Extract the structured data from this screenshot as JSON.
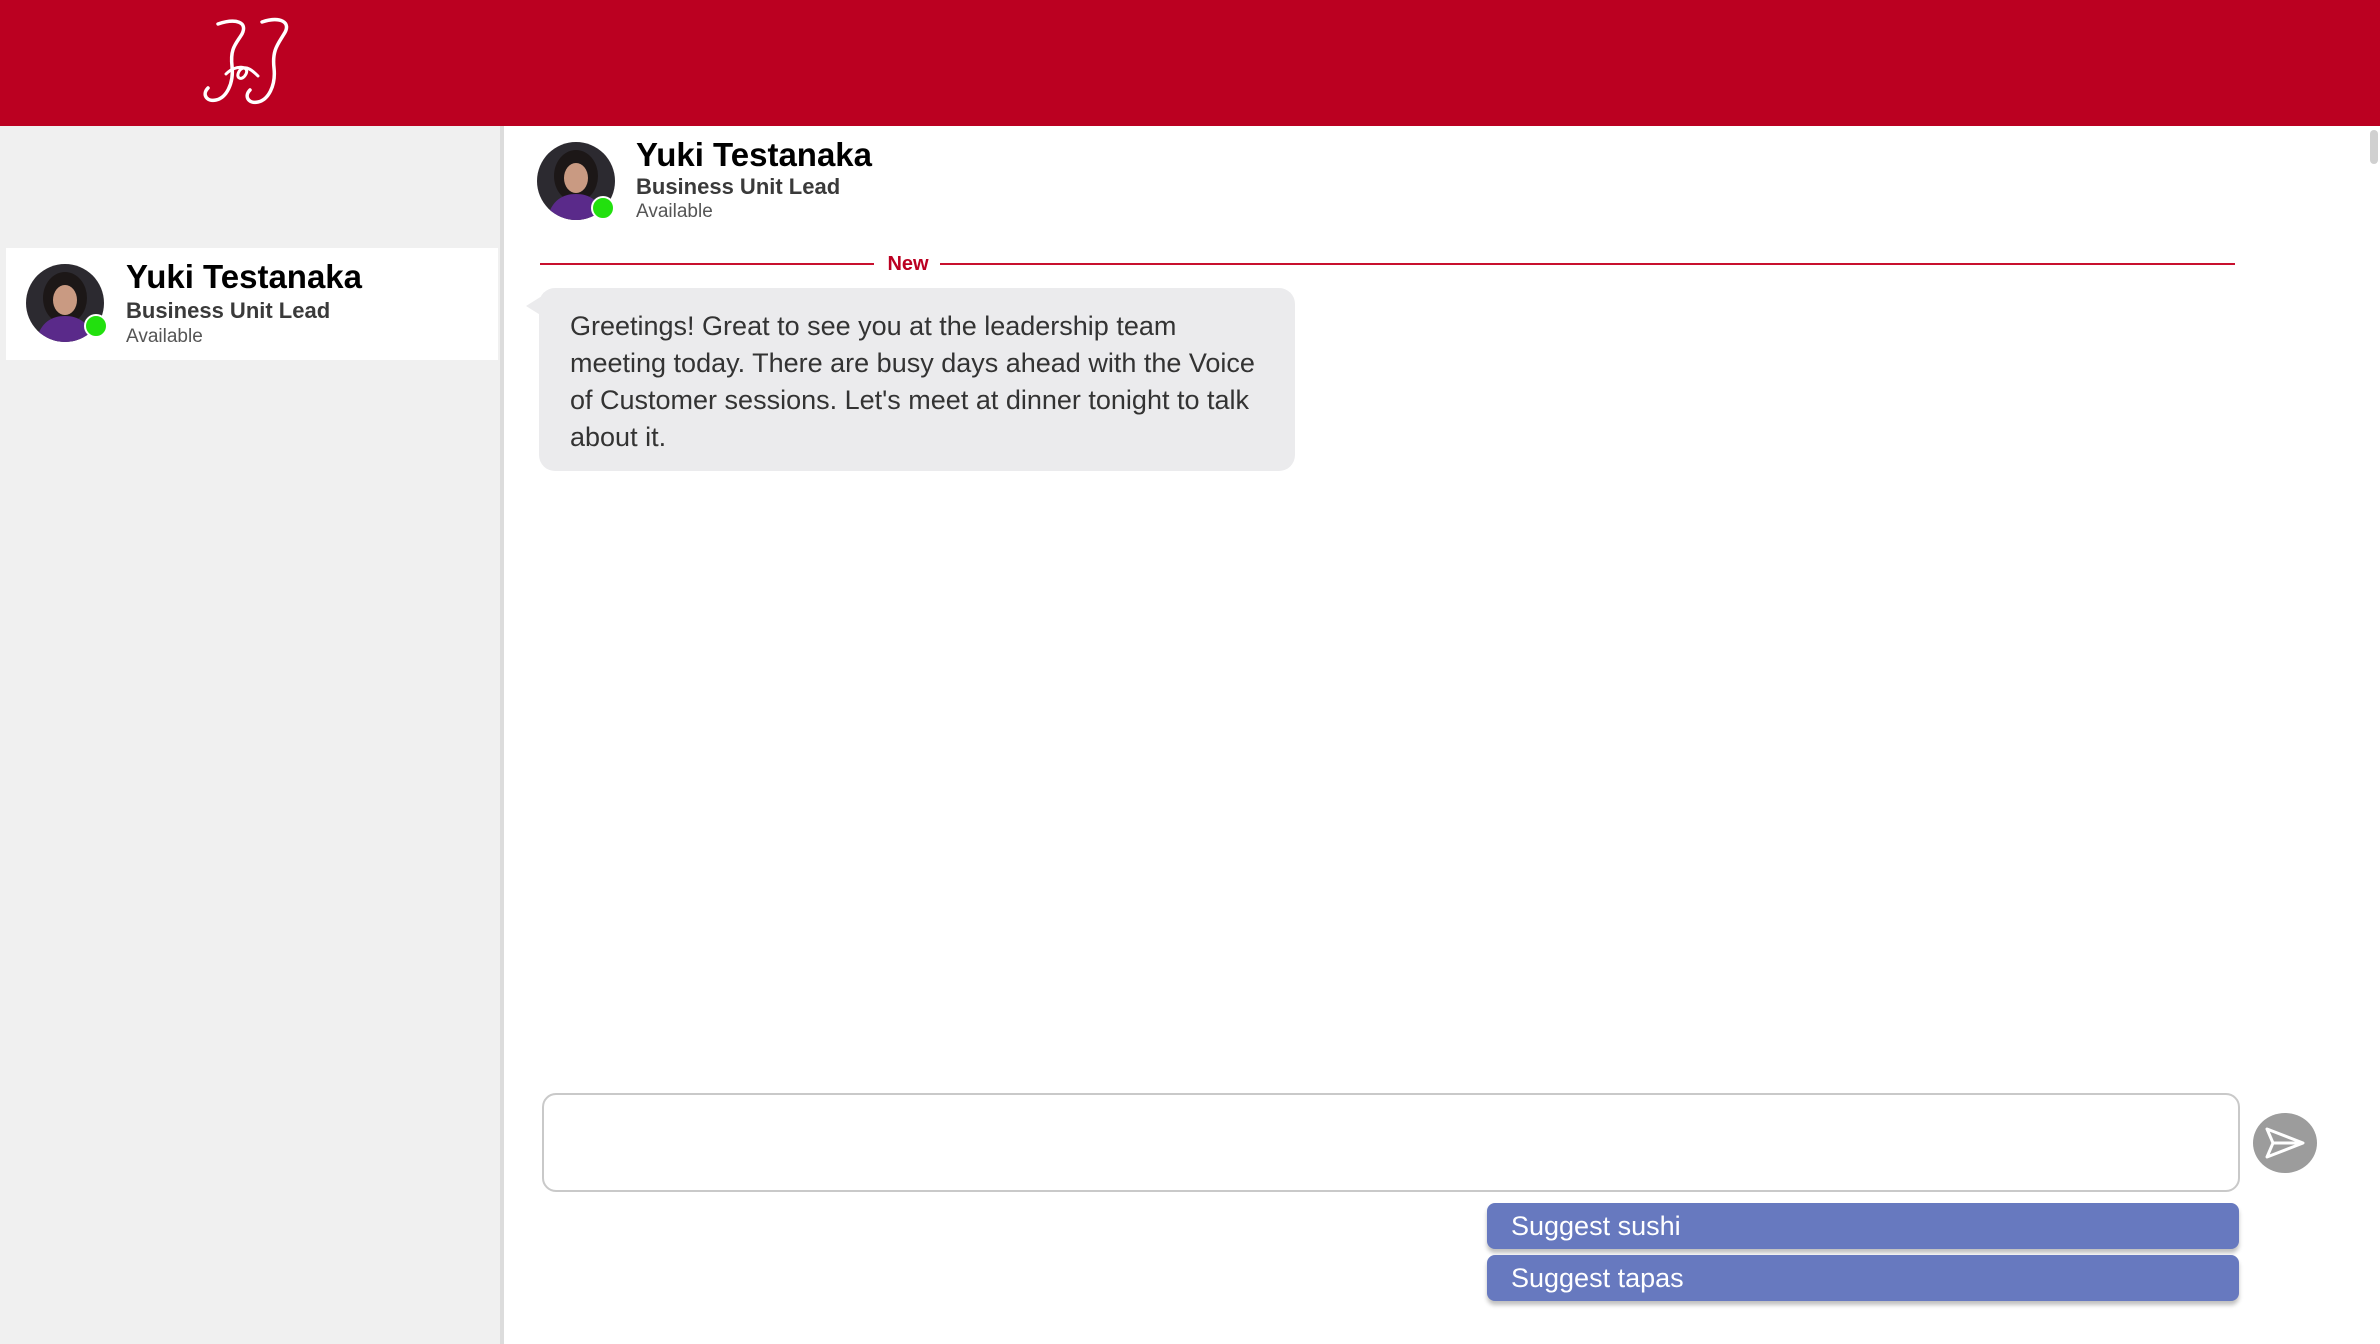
{
  "brand": {
    "logo_text": "J&J",
    "accent_color": "#bb0021"
  },
  "sidebar": {
    "contacts": [
      {
        "name": "Yuki Testanaka",
        "role": "Business Unit Lead",
        "status": "Available",
        "status_color": "#22e00e"
      }
    ]
  },
  "chat": {
    "header": {
      "name": "Yuki Testanaka",
      "role": "Business Unit Lead",
      "status": "Available"
    },
    "divider_label": "New",
    "messages": [
      {
        "text": "Greetings! Great to see you at the leadership team meeting today. There are busy days ahead with the Voice of Customer sessions. Let's meet at dinner tonight to talk about it."
      }
    ],
    "composer": {
      "value": "",
      "placeholder": ""
    },
    "suggestions": [
      "Suggest sushi",
      "Suggest tapas"
    ]
  }
}
